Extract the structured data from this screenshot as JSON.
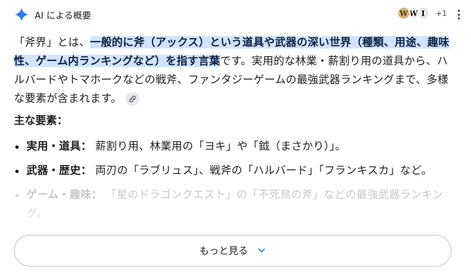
{
  "header": {
    "title": "AI による概要"
  },
  "sources": {
    "favicon1": "W",
    "favicon2": "W",
    "favicon3": "I",
    "more": "+1"
  },
  "overview": {
    "p_open": "「斧界」とは、",
    "p_highlight": "一般的に斧（アックス）という道具や武器の深い世界（種類、用途、趣味性、ゲーム内ランキングなど）を指す言葉",
    "p_rest": "です。実用的な林業・薪割り用の道具から、ハルバードやトマホークなどの戦斧、ファンタジーゲームの最強武器ランキングまで、多様な要素が含まれます。"
  },
  "section": {
    "title": "主な要素："
  },
  "items": [
    {
      "term": "実用・道具：",
      "text": "薪割り用、林業用の「ヨキ」や「鉞（まさかり）」。"
    },
    {
      "term": "武器・歴史：",
      "text": "両刃の「ラブリュス」、戦斧の「ハルバード」「フランキスカ」など。"
    },
    {
      "term": "ゲーム・趣味：",
      "text": "「星のドラゴンクエスト」の「不死鳥の斧」などの最強武器ランキング。"
    }
  ],
  "more_button": {
    "label": "もっと見る"
  },
  "colors": {
    "highlight": "#d3e3fd",
    "accent": "#1a73e8",
    "spark_blue": "#4285f4"
  },
  "icons": {
    "spark": "gemini-spark-icon",
    "link": "link-icon",
    "chevron": "chevron-down-icon",
    "menu": "more-vert-icon"
  }
}
